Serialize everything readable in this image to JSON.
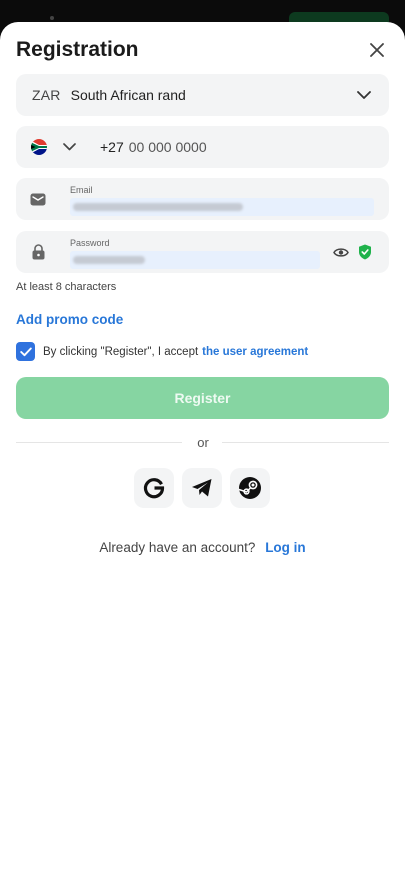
{
  "header": {
    "title": "Registration",
    "close_icon": "close-icon"
  },
  "currency": {
    "code": "ZAR",
    "name": "South African rand"
  },
  "phone": {
    "country_flag": "south-africa-flag-icon",
    "prefix": "+27",
    "placeholder": "00 000 0000"
  },
  "email": {
    "label": "Email"
  },
  "password": {
    "label": "Password",
    "hint": "At least 8 characters"
  },
  "promo": {
    "label": "Add promo code"
  },
  "agreement": {
    "checked": true,
    "text": "By clicking \"Register\", I accept",
    "link": "the user agreement"
  },
  "register": {
    "label": "Register"
  },
  "divider": {
    "label": "or"
  },
  "social": [
    "google-icon",
    "telegram-icon",
    "steam-icon"
  ],
  "login": {
    "question": "Already have an account?",
    "link": "Log in"
  },
  "colors": {
    "accent": "#2877d8",
    "register_disabled": "#86d5a2",
    "shield": "#1fb24b",
    "checkbox": "#2f72de"
  }
}
